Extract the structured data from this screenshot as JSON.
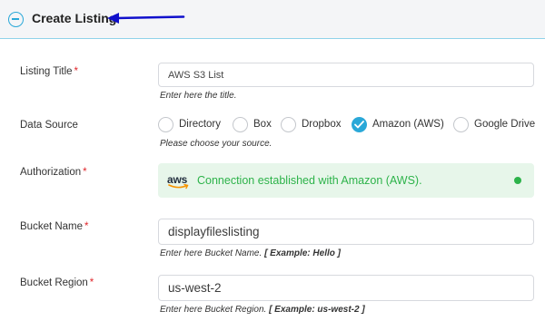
{
  "header": {
    "title": "Create Listing"
  },
  "form": {
    "required_marker": "*",
    "listing_title": {
      "label": "Listing Title",
      "value": "AWS S3 List",
      "help": "Enter here the title."
    },
    "data_source": {
      "label": "Data Source",
      "options": [
        "Directory",
        "Box",
        "Dropbox",
        "Amazon (AWS)",
        "Google Drive"
      ],
      "selected": "Amazon (AWS)",
      "help": "Please choose your source."
    },
    "authorization": {
      "label": "Authorization",
      "logo_text": "aws",
      "message": "Connection established with Amazon (AWS).",
      "status_color": "#2db34a"
    },
    "bucket_name": {
      "label": "Bucket Name",
      "value": "displayfileslisting",
      "help_prefix": "Enter here Bucket Name.",
      "help_example": "[ Example: Hello ]"
    },
    "bucket_region": {
      "label": "Bucket Region",
      "value": "us-west-2",
      "help_prefix": "Enter here Bucket Region.",
      "help_example": "[ Example: us-west-2 ]"
    }
  },
  "colors": {
    "accent": "#2aa8d8",
    "annotation_arrow": "#1010cc",
    "required": "#e0262b",
    "success": "#2db34a"
  }
}
